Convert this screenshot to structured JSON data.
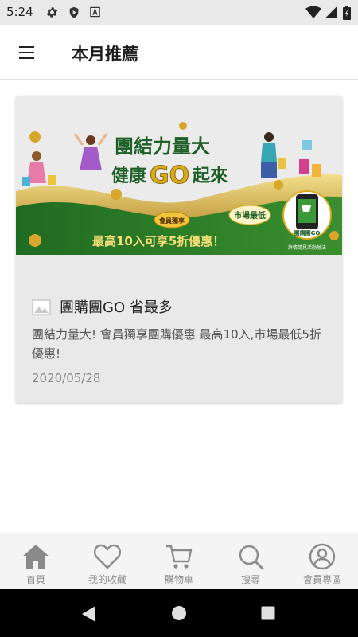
{
  "status_bar": {
    "time": "5:24",
    "icons": [
      "gear-icon",
      "shield-play-icon",
      "font-a-icon",
      "wifi-icon",
      "signal-icon",
      "battery-icon"
    ]
  },
  "app_bar": {
    "menu_icon": "hamburger-icon",
    "title": "本月推薦"
  },
  "card": {
    "banner": {
      "headline_line1": "團結力量大",
      "headline_line2_a": "健康",
      "headline_line2_go": "GO",
      "headline_line2_b": "起來",
      "badge_member": "會員獨享",
      "badge_market": "市場最低",
      "offer_text": "最高10入可享5折優惠！",
      "phone_label": "團購團GO",
      "fineprint": "詳情請見活動辦法"
    },
    "title": "團購團GO 省最多",
    "description": "團結力量大! 會員獨享團購優惠 最高10入,市場最低5折優惠!",
    "date": "2020/05/28"
  },
  "bottom_nav": [
    {
      "label": "首頁",
      "icon": "home-icon"
    },
    {
      "label": "我的收藏",
      "icon": "heart-icon"
    },
    {
      "label": "購物車",
      "icon": "cart-icon"
    },
    {
      "label": "搜尋",
      "icon": "search-icon"
    },
    {
      "label": "會員專區",
      "icon": "account-icon"
    }
  ],
  "system_nav": [
    "back-icon",
    "home-circle-icon",
    "recents-icon"
  ],
  "colors": {
    "brand_green": "#2f7a2a",
    "gold": "#c9a227",
    "nav_icon": "#8a8a8a"
  }
}
